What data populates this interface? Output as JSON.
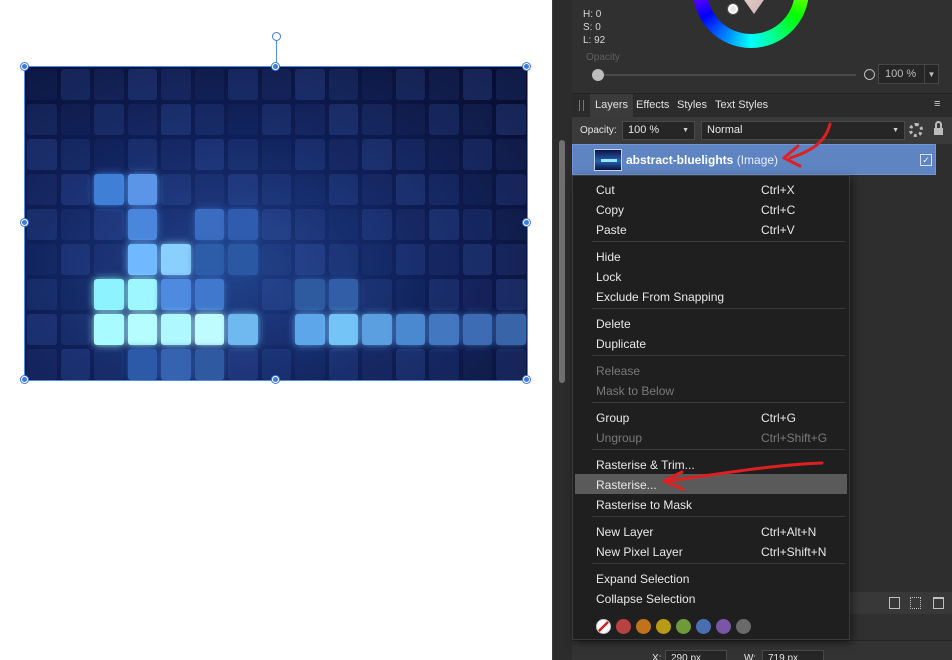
{
  "color_panel": {
    "h_label": "H: 0",
    "s_label": "S: 0",
    "l_label": "L: 92",
    "opacity_label": "Opacity",
    "opacity_value": "100 %"
  },
  "tabs": [
    {
      "label": "Layers",
      "active": true
    },
    {
      "label": "Effects",
      "active": false
    },
    {
      "label": "Styles",
      "active": false
    },
    {
      "label": "Text Styles",
      "active": false
    }
  ],
  "panel_menu_glyph": "≡",
  "layers_toolbar": {
    "opacity_label": "Opacity:",
    "opacity_value": "100 %",
    "blend_mode": "Normal"
  },
  "layer": {
    "name": "abstract-bluelights",
    "type": "(Image)",
    "visible_check": "✓"
  },
  "context_menu": {
    "groups": [
      [
        {
          "label": "Cut",
          "shortcut": "Ctrl+X",
          "enabled": true
        },
        {
          "label": "Copy",
          "shortcut": "Ctrl+C",
          "enabled": true
        },
        {
          "label": "Paste",
          "shortcut": "Ctrl+V",
          "enabled": true
        }
      ],
      [
        {
          "label": "Hide",
          "shortcut": "",
          "enabled": true
        },
        {
          "label": "Lock",
          "shortcut": "",
          "enabled": true
        },
        {
          "label": "Exclude From Snapping",
          "shortcut": "",
          "enabled": true
        }
      ],
      [
        {
          "label": "Delete",
          "shortcut": "",
          "enabled": true
        },
        {
          "label": "Duplicate",
          "shortcut": "",
          "enabled": true
        }
      ],
      [
        {
          "label": "Release",
          "shortcut": "",
          "enabled": false
        },
        {
          "label": "Mask to Below",
          "shortcut": "",
          "enabled": false
        }
      ],
      [
        {
          "label": "Group",
          "shortcut": "Ctrl+G",
          "enabled": true
        },
        {
          "label": "Ungroup",
          "shortcut": "Ctrl+Shift+G",
          "enabled": false
        }
      ],
      [
        {
          "label": "Rasterise & Trim...",
          "shortcut": "",
          "enabled": true
        },
        {
          "label": "Rasterise...",
          "shortcut": "",
          "enabled": true,
          "hover": true
        },
        {
          "label": "Rasterise to Mask",
          "shortcut": "",
          "enabled": true
        }
      ],
      [
        {
          "label": "New Layer",
          "shortcut": "Ctrl+Alt+N",
          "enabled": true
        },
        {
          "label": "New Pixel Layer",
          "shortcut": "Ctrl+Shift+N",
          "enabled": true
        }
      ],
      [
        {
          "label": "Expand Selection",
          "shortcut": "",
          "enabled": true
        },
        {
          "label": "Collapse Selection",
          "shortcut": "",
          "enabled": true
        }
      ]
    ],
    "color_tags": [
      "none",
      "#b84242",
      "#c1731b",
      "#b89a14",
      "#6e9a3a",
      "#4a6fb0",
      "#7a55a8",
      "#6a6a6a"
    ]
  },
  "transform": {
    "x_label": "X:",
    "x_value": "290 px",
    "w_label": "W:",
    "w_value": "719 px"
  },
  "colors": {
    "selection_blue": "#4f8fe0",
    "layer_highlight": "#5f84c2",
    "annotation_red": "#e02020"
  }
}
